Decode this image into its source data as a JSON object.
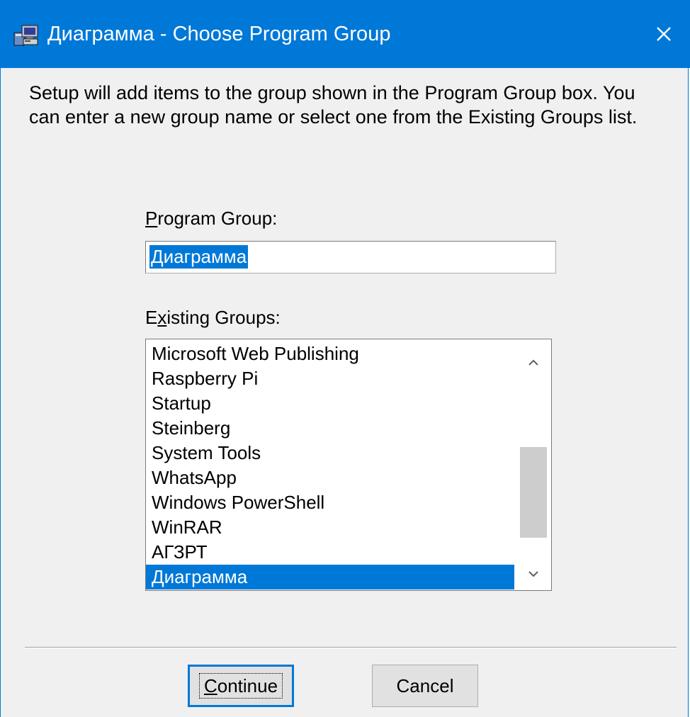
{
  "window": {
    "title": "Диаграмма - Choose Program Group",
    "app_icon": "setup-computer-icon",
    "close_icon": "close-icon"
  },
  "description": "Setup will add items to the group shown in the Program Group box. You can enter a new group name or select one from the Existing Groups list.",
  "program_group": {
    "label_mnemonic": "P",
    "label_rest": "rogram Group:",
    "value": "Диаграмма"
  },
  "existing_groups": {
    "label_before": "E",
    "label_mnemonic": "x",
    "label_rest": "isting Groups:",
    "items": [
      "Microsoft Web Publishing",
      "Raspberry Pi",
      "Startup",
      "Steinberg",
      "System Tools",
      "WhatsApp",
      "Windows PowerShell",
      "WinRAR",
      "АГЗРТ",
      "Диаграмма"
    ],
    "selected": "Диаграмма",
    "scroll_up_icon": "chevron-up-icon",
    "scroll_down_icon": "chevron-down-icon"
  },
  "buttons": {
    "continue_mnemonic": "C",
    "continue_rest": "ontinue",
    "cancel": "Cancel"
  },
  "colors": {
    "titlebar": "#0078d7",
    "selection": "#0078d7",
    "dialog_bg": "#f0f0f0"
  }
}
